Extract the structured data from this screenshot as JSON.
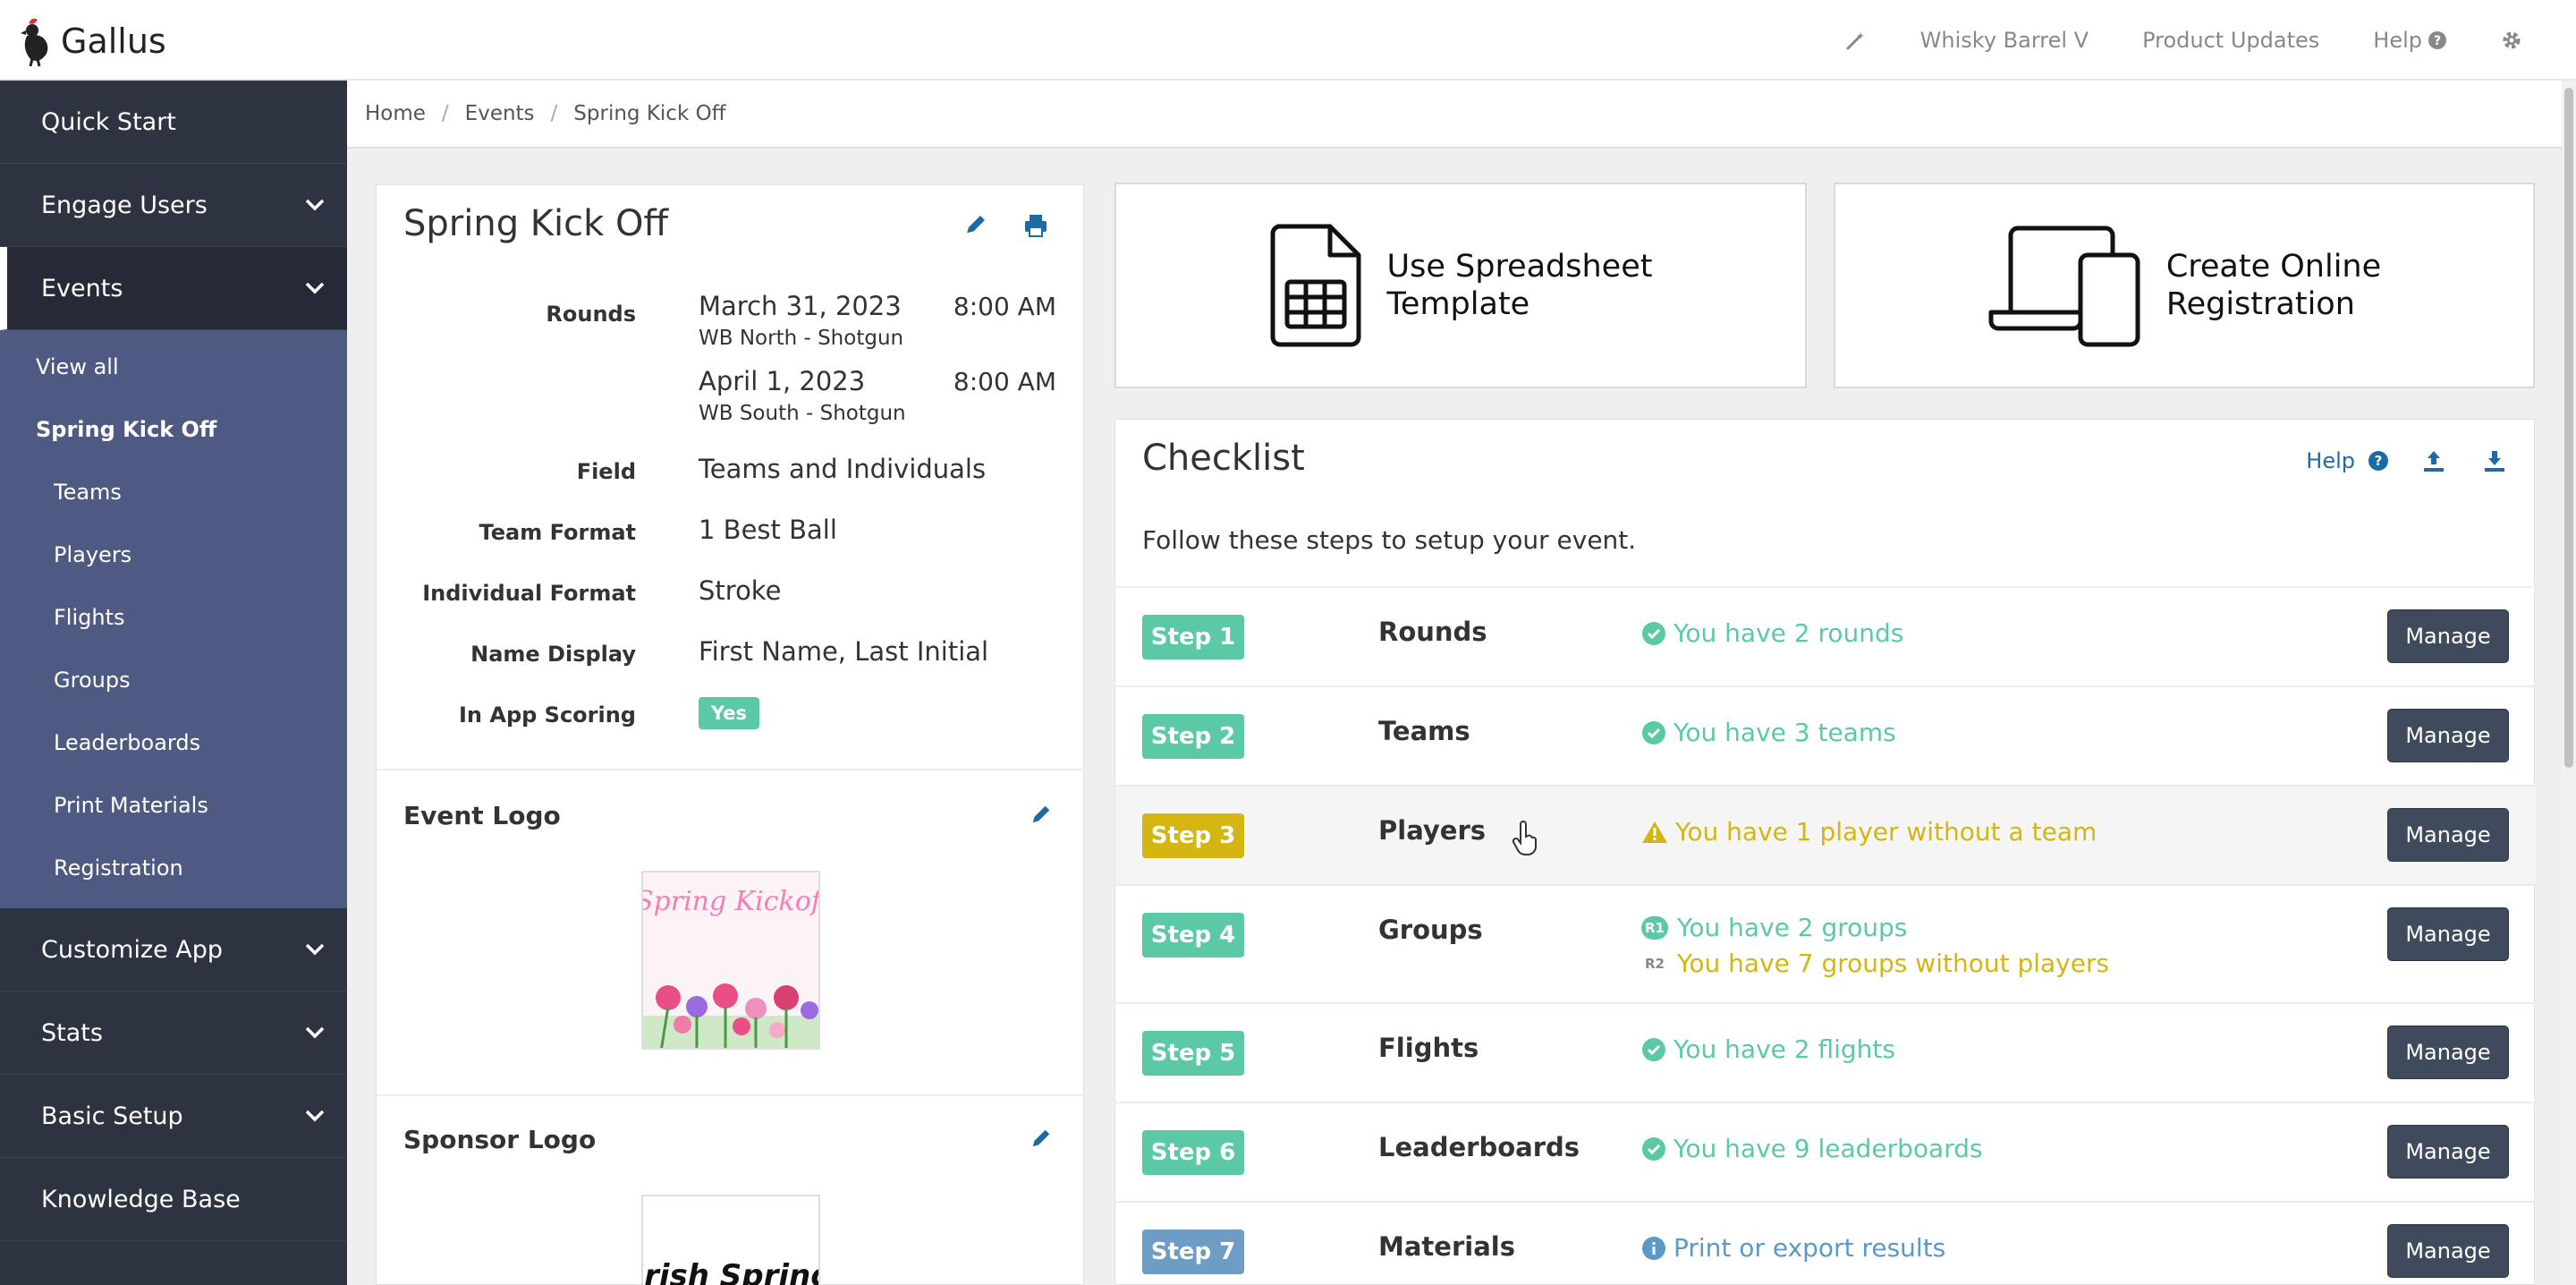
{
  "app": {
    "name": "Gallus"
  },
  "topnav": {
    "org": "Whisky Barrel V",
    "updates": "Product Updates",
    "help": "Help"
  },
  "sidebar": {
    "quick_start": "Quick Start",
    "engage_users": "Engage Users",
    "events": "Events",
    "events_sub": {
      "view_all": "View all",
      "current_event": "Spring Kick Off",
      "items": [
        "Teams",
        "Players",
        "Flights",
        "Groups",
        "Leaderboards",
        "Print Materials",
        "Registration"
      ]
    },
    "customize_app": "Customize App",
    "stats": "Stats",
    "basic_setup": "Basic Setup",
    "knowledge_base": "Knowledge Base"
  },
  "breadcrumb": [
    "Home",
    "Events",
    "Spring Kick Off"
  ],
  "event": {
    "title": "Spring Kick Off",
    "labels": {
      "rounds": "Rounds",
      "field": "Field",
      "team_format": "Team Format",
      "individual_format": "Individual Format",
      "name_display": "Name Display",
      "in_app_scoring": "In App Scoring"
    },
    "rounds": [
      {
        "date": "March 31, 2023",
        "time": "8:00 AM",
        "course": "WB North - Shotgun"
      },
      {
        "date": "April 1, 2023",
        "time": "8:00 AM",
        "course": "WB South - Shotgun"
      }
    ],
    "field": "Teams and Individuals",
    "team_format": "1 Best Ball",
    "individual_format": "Stroke",
    "name_display": "First Name, Last Initial",
    "in_app_scoring": "Yes",
    "event_logo_title": "Event Logo",
    "event_logo_text": "Spring Kickoff",
    "sponsor_logo_title": "Sponsor Logo",
    "sponsor_logo_text": "Irish Spring"
  },
  "cards": {
    "spreadsheet": {
      "line1": "Use Spreadsheet",
      "line2": "Template"
    },
    "online": {
      "line1": "Create Online",
      "line2": "Registration"
    }
  },
  "checklist": {
    "title": "Checklist",
    "help": "Help",
    "intro": "Follow these steps to setup your event.",
    "manage_label": "Manage",
    "steps": [
      {
        "step": "Step 1",
        "name": "Rounds",
        "status": "You have 2 rounds"
      },
      {
        "step": "Step 2",
        "name": "Teams",
        "status": "You have 3 teams"
      },
      {
        "step": "Step 3",
        "name": "Players",
        "status": "You have 1 player without a team"
      },
      {
        "step": "Step 4",
        "name": "Groups",
        "status": "You have 2 groups",
        "status2": "You have 7 groups without players",
        "tag1": "R1",
        "tag2": "R2"
      },
      {
        "step": "Step 5",
        "name": "Flights",
        "status": "You have 2 flights"
      },
      {
        "step": "Step 6",
        "name": "Leaderboards",
        "status": "You have 9 leaderboards"
      },
      {
        "step": "Step 7",
        "name": "Materials",
        "status": "Print or export results"
      }
    ]
  },
  "colors": {
    "green": "#5bc9a5",
    "yellow": "#d4b512",
    "blue": "#5a99c8",
    "sidebar": "#2d3341",
    "submenu": "#4f5a83",
    "link": "#1d6aa5"
  }
}
